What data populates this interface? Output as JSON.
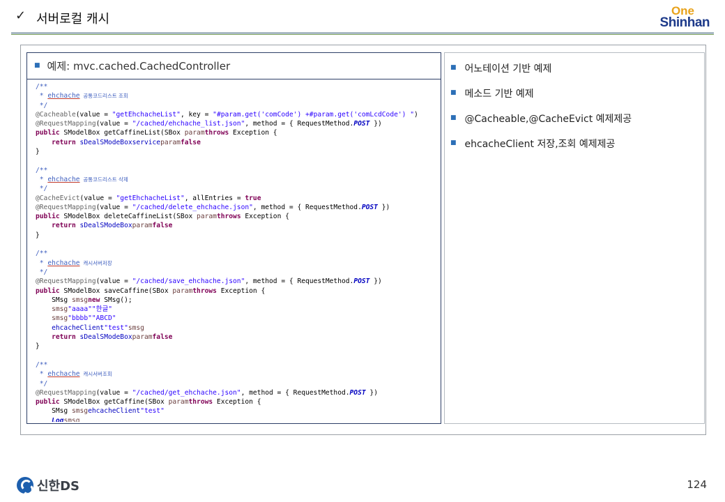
{
  "header": {
    "check": "✓",
    "title": "서버로컬 캐시",
    "logo_one": "One",
    "logo_main": "Shinhan"
  },
  "left_panel": {
    "heading": "예제: mvc.cached.CachedController"
  },
  "code_lines": [
    [
      [
        "c-comment",
        "/**"
      ]
    ],
    [
      [
        "c-comment",
        " * "
      ],
      [
        "c-comment c-under",
        "ehchache"
      ],
      [
        "c-small",
        "  공통코드리스트 조회"
      ]
    ],
    [
      [
        "c-comment",
        " */"
      ]
    ],
    [
      [
        "c-ann",
        "@Cacheable"
      ],
      [
        "",
        "(value = "
      ],
      [
        "c-str",
        "\"getEhchacheList\""
      ],
      [
        "",
        ", key = "
      ],
      [
        "c-str",
        "\"#param.get('comCode') +#param.get('comLcdCode') \""
      ],
      [
        "",
        ")"
      ]
    ],
    [
      [
        "c-ann",
        "@RequestMapping"
      ],
      [
        "",
        "(value = "
      ],
      [
        "c-str",
        "\"/cached/ehchache_list.json\""
      ],
      [
        "",
        ", method = { RequestMethod."
      ],
      [
        "c-it",
        "POST"
      ],
      [
        "",
        " })"
      ]
    ],
    [
      [
        "c-kw",
        "public"
      ],
      [
        "",
        " SModelBox getCaffineList(SBox "
      ],
      [
        "c-var",
        "param"
      ],
      [
        ") "
      ],
      [
        "c-kw",
        "throws"
      ],
      [
        "",
        " Exception {"
      ]
    ],
    [
      [
        "",
        "    "
      ],
      [
        "c-kw",
        "return"
      ],
      [
        "",
        " "
      ],
      [
        "c-fld",
        "sDealSModeBox"
      ],
      [
        ".setResultValue("
      ],
      [
        "c-fld",
        "service"
      ],
      [
        ".selectComCodeList("
      ],
      [
        "c-var",
        "param"
      ],
      [
        "), "
      ],
      [
        "c-kw",
        "false"
      ],
      [
        ");"
      ]
    ],
    [
      [
        "",
        "}"
      ]
    ],
    [
      [
        "",
        ""
      ]
    ],
    [
      [
        "c-comment",
        "/**"
      ]
    ],
    [
      [
        "c-comment",
        " * "
      ],
      [
        "c-comment c-under",
        "ehchache"
      ],
      [
        "c-small",
        "  공통코드리스트 삭제"
      ]
    ],
    [
      [
        "c-comment",
        " */"
      ]
    ],
    [
      [
        "c-ann",
        "@CacheEvict"
      ],
      [
        "",
        "(value = "
      ],
      [
        "c-str",
        "\"getEhchacheList\""
      ],
      [
        "",
        ", allEntries = "
      ],
      [
        "c-kw",
        "true"
      ],
      [
        ")"
      ]
    ],
    [
      [
        "c-ann",
        "@RequestMapping"
      ],
      [
        "",
        "(value = "
      ],
      [
        "c-str",
        "\"/cached/delete_ehchache.json\""
      ],
      [
        "",
        ", method = { RequestMethod."
      ],
      [
        "c-it",
        "POST"
      ],
      [
        "",
        " })"
      ]
    ],
    [
      [
        "c-kw",
        "public"
      ],
      [
        "",
        " SModelBox deleteCaffineList(SBox "
      ],
      [
        "c-var",
        "param"
      ],
      [
        ") "
      ],
      [
        "c-kw",
        "throws"
      ],
      [
        "",
        " Exception {"
      ]
    ],
    [
      [
        "",
        "    "
      ],
      [
        "c-kw",
        "return"
      ],
      [
        "",
        " "
      ],
      [
        "c-fld",
        "sDealSModeBox"
      ],
      [
        ".setResultValue("
      ],
      [
        "c-var",
        "param"
      ],
      [
        ", "
      ],
      [
        "c-kw",
        "false"
      ],
      [
        ");"
      ]
    ],
    [
      [
        "",
        "}"
      ]
    ],
    [
      [
        "",
        ""
      ]
    ],
    [
      [
        "c-comment",
        "/**"
      ]
    ],
    [
      [
        "c-comment",
        " * "
      ],
      [
        "c-comment c-under",
        "ehchache"
      ],
      [
        "c-small",
        "  캐시서버저장"
      ]
    ],
    [
      [
        "c-comment",
        " */"
      ]
    ],
    [
      [
        "c-ann",
        "@RequestMapping"
      ],
      [
        "",
        "(value = "
      ],
      [
        "c-str",
        "\"/cached/save_ehchache.json\""
      ],
      [
        "",
        ", method = { RequestMethod."
      ],
      [
        "c-it",
        "POST"
      ],
      [
        "",
        " })"
      ]
    ],
    [
      [
        "c-kw",
        "public"
      ],
      [
        "",
        " SModelBox saveCaffine(SBox "
      ],
      [
        "c-var",
        "param"
      ],
      [
        ") "
      ],
      [
        "c-kw",
        "throws"
      ],
      [
        "",
        " Exception {"
      ]
    ],
    [
      [
        "",
        "    SMsg "
      ],
      [
        "c-var",
        "smsg"
      ],
      [
        " = "
      ],
      [
        "c-kw",
        "new"
      ],
      [
        "",
        " SMsg();"
      ]
    ],
    [
      [
        "",
        "    "
      ],
      [
        "c-var",
        "smsg"
      ],
      [
        ".put("
      ],
      [
        "c-str",
        "\"aaaa\""
      ],
      [
        ", "
      ],
      [
        "c-str",
        "\"한글\""
      ],
      [
        ");"
      ]
    ],
    [
      [
        "",
        "    "
      ],
      [
        "c-var",
        "smsg"
      ],
      [
        ".put("
      ],
      [
        "c-str",
        "\"bbbb\""
      ],
      [
        ", "
      ],
      [
        "c-str",
        "\"ABCD\""
      ],
      [
        ");"
      ]
    ],
    [
      [
        "",
        "    "
      ],
      [
        "c-fld",
        "ehcacheClient"
      ],
      [
        ".add("
      ],
      [
        "c-str",
        "\"test\""
      ],
      [
        ", "
      ],
      [
        "c-var",
        "smsg"
      ],
      [
        ");"
      ]
    ],
    [
      [
        "",
        "    "
      ],
      [
        "c-kw",
        "return"
      ],
      [
        "",
        " "
      ],
      [
        "c-fld",
        "sDealSModeBox"
      ],
      [
        ".setResultValue("
      ],
      [
        "c-var",
        "param"
      ],
      [
        ", "
      ],
      [
        "c-kw",
        "false"
      ],
      [
        ");"
      ]
    ],
    [
      [
        "",
        "}"
      ]
    ],
    [
      [
        "",
        ""
      ]
    ],
    [
      [
        "c-comment",
        "/**"
      ]
    ],
    [
      [
        "c-comment",
        " * "
      ],
      [
        "c-comment c-under",
        "ehchache"
      ],
      [
        "c-small",
        "  캐시서버조회"
      ]
    ],
    [
      [
        "c-comment",
        " */"
      ]
    ],
    [
      [
        "c-ann",
        "@RequestMapping"
      ],
      [
        "",
        "(value = "
      ],
      [
        "c-str",
        "\"/cached/get_ehchache.json\""
      ],
      [
        "",
        ", method = { RequestMethod."
      ],
      [
        "c-it",
        "POST"
      ],
      [
        "",
        " })"
      ]
    ],
    [
      [
        "c-kw",
        "public"
      ],
      [
        "",
        " SModelBox getCaffine(SBox "
      ],
      [
        "c-var",
        "param"
      ],
      [
        ") "
      ],
      [
        "c-kw",
        "throws"
      ],
      [
        "",
        " Exception {"
      ]
    ],
    [
      [
        "",
        "    SMsg "
      ],
      [
        "c-var",
        "smsg"
      ],
      [
        " ="
      ],
      [
        "c-fld",
        "ehcacheClient"
      ],
      [
        ".get("
      ],
      [
        "c-str",
        "\"test\""
      ],
      [
        ");"
      ]
    ],
    [
      [
        "",
        "    "
      ],
      [
        "c-it",
        "Log"
      ],
      [
        ".debug("
      ],
      [
        "c-var",
        "smsg"
      ],
      [
        ".toString());"
      ]
    ]
  ],
  "right_panel": {
    "items": [
      "어노테이션 기반 예제",
      "메소드 기반 예제",
      "@Cacheable,@CacheEvict 예제제공",
      "ehcacheClient 저장,조회 예제제공"
    ]
  },
  "footer": {
    "brand": "신한DS",
    "page_number": "124"
  },
  "colors": {
    "accent_blue": "#1d3a8a",
    "accent_orange": "#e8a21a",
    "bullet": "#2c6fb7"
  }
}
